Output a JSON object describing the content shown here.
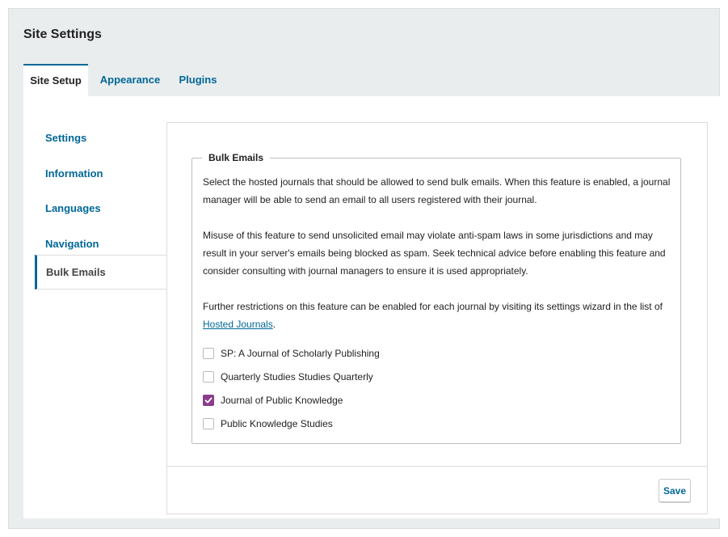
{
  "page": {
    "title": "Site Settings"
  },
  "tabs": [
    {
      "label": "Site Setup",
      "active": true
    },
    {
      "label": "Appearance",
      "active": false
    },
    {
      "label": "Plugins",
      "active": false
    }
  ],
  "sidebar": {
    "items": [
      {
        "label": "Settings",
        "active": false
      },
      {
        "label": "Information",
        "active": false
      },
      {
        "label": "Languages",
        "active": false
      },
      {
        "label": "Navigation",
        "active": false
      },
      {
        "label": "Bulk Emails",
        "active": true
      }
    ]
  },
  "bulk_emails": {
    "legend": "Bulk Emails",
    "description_1": "Select the hosted journals that should be allowed to send bulk emails. When this feature is enabled, a journal manager will be able to send an email to all users registered with their journal.",
    "description_2": "Misuse of this feature to send unsolicited email may violate anti-spam laws in some jurisdictions and may result in your server's emails being blocked as spam. Seek technical advice before enabling this feature and consider consulting with journal managers to ensure it is used appropriately.",
    "description_3_prefix": "Further restrictions on this feature can be enabled for each journal by visiting its settings wizard in the list of ",
    "description_3_link": "Hosted Journals",
    "description_3_suffix": ".",
    "journals": [
      {
        "label": "SP: A Journal of Scholarly Publishing",
        "checked": false
      },
      {
        "label": "Quarterly Studies Studies Quarterly",
        "checked": false
      },
      {
        "label": "Journal of Public Knowledge",
        "checked": true
      },
      {
        "label": "Public Knowledge Studies",
        "checked": false
      }
    ]
  },
  "footer": {
    "save_label": "Save"
  },
  "colors": {
    "accent": "#006798",
    "checkbox_checked": "#8b3d8b",
    "background": "#eaedee"
  }
}
